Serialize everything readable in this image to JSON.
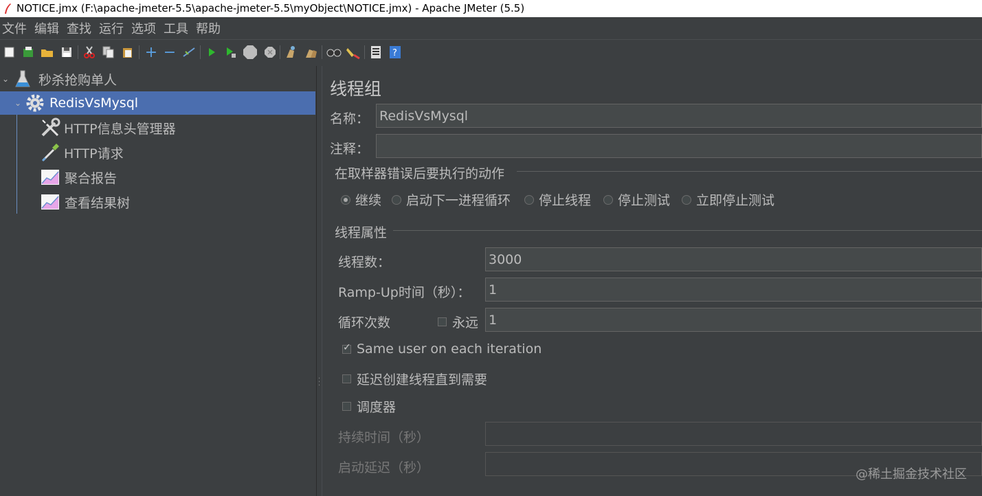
{
  "window": {
    "title": "NOTICE.jmx (F:\\apache-jmeter-5.5\\apache-jmeter-5.5\\myObject\\NOTICE.jmx) - Apache JMeter (5.5)"
  },
  "menu": [
    "文件",
    "编辑",
    "查找",
    "运行",
    "选项",
    "工具",
    "帮助"
  ],
  "toolbar": {
    "icons": [
      "new-icon",
      "templates-icon",
      "open-icon",
      "save-icon",
      "cut-icon",
      "copy-icon",
      "paste-icon",
      "expand-icon",
      "collapse-icon",
      "toggle-icon",
      "start-icon",
      "start-no-pause-icon",
      "stop-icon",
      "shutdown-icon",
      "clear-icon",
      "clear-all-icon",
      "search-icon",
      "reset-search-icon",
      "function-helper-icon",
      "help-icon"
    ],
    "glyphs": {
      "expand": "+",
      "collapse": "−"
    }
  },
  "tree": {
    "root": "秒杀抢购单人",
    "thread_group": "RedisVsMysql",
    "children": [
      "HTTP信息头管理器",
      "HTTP请求",
      "聚合报告",
      "查看结果树"
    ]
  },
  "panel": {
    "title": "线程组",
    "name_label": "名称：",
    "name_value": "RedisVsMysql",
    "comment_label": "注释：",
    "comment_value": "",
    "error_action_title": "在取样器错误后要执行的动作",
    "error_actions": [
      "继续",
      "启动下一进程循环",
      "停止线程",
      "停止测试",
      "立即停止测试"
    ],
    "error_action_selected": 0,
    "thread_props_title": "线程属性",
    "threads_label": "线程数：",
    "threads_value": "3000",
    "rampup_label": "Ramp-Up时间（秒）：",
    "rampup_value": "1",
    "loop_label": "循环次数",
    "forever_label": "永远",
    "forever_checked": false,
    "loop_value": "1",
    "same_user_label": "Same user on each iteration",
    "same_user_checked": true,
    "delay_label": "延迟创建线程直到需要",
    "delay_checked": false,
    "scheduler_label": "调度器",
    "scheduler_checked": false,
    "duration_label": "持续时间（秒）",
    "startup_delay_label": "启动延迟（秒）"
  },
  "watermark": "@稀土掘金技术社区",
  "colors": {
    "background": "#3c3f41",
    "selection": "#4b6eaf",
    "field": "#45494a",
    "text": "#bbbbbb"
  }
}
